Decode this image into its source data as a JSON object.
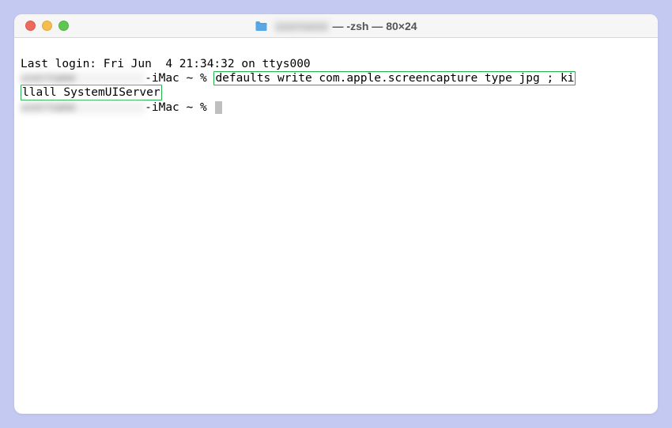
{
  "titlebar": {
    "blurred_prefix": "username",
    "title_suffix": " — -zsh — 80×24"
  },
  "terminal": {
    "line1": "Last login: Fri Jun  4 21:34:32 on ttys000",
    "prompt1": {
      "blurred_host": "username          ",
      "visible_host": "-iMac",
      "path_sep": " ~ % ",
      "cmd_part1": "defaults write com.apple.screencapture type jpg ; ki",
      "cmd_part2": "llall SystemUIServer"
    },
    "prompt2": {
      "blurred_host": "username          ",
      "visible_host": "-iMac",
      "path_sep": " ~ % "
    }
  }
}
